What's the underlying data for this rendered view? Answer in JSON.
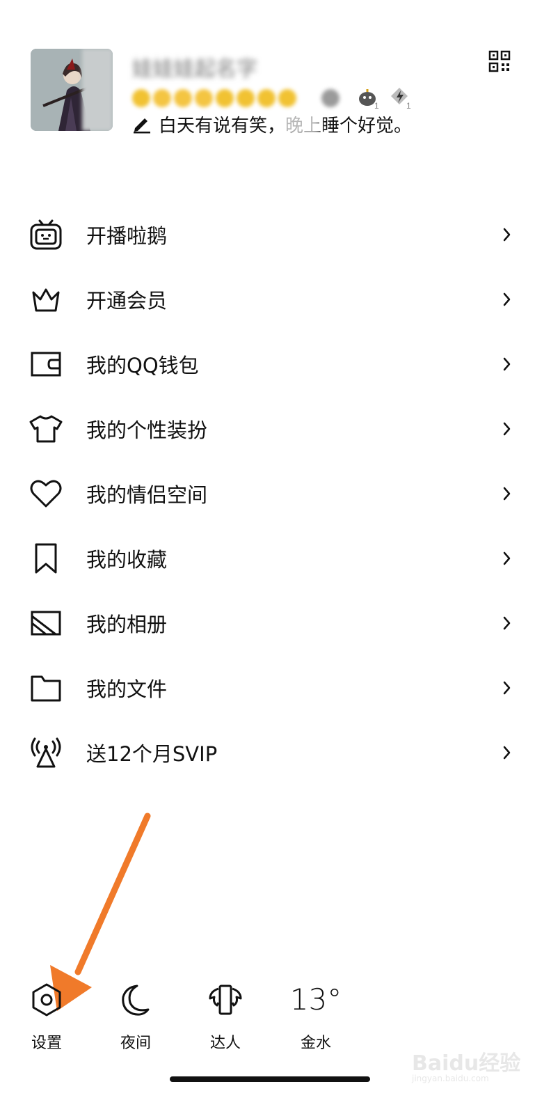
{
  "profile": {
    "nickname": "娃娃娃起名字",
    "signature": "白天有说有笑，晚上睡个好觉。"
  },
  "menu": [
    {
      "label": "开播啦鹅",
      "icon": "tv-icon"
    },
    {
      "label": "开通会员",
      "icon": "crown-icon"
    },
    {
      "label": "我的QQ钱包",
      "icon": "wallet-icon"
    },
    {
      "label": "我的个性装扮",
      "icon": "tshirt-icon"
    },
    {
      "label": "我的情侣空间",
      "icon": "heart-icon"
    },
    {
      "label": "我的收藏",
      "icon": "bookmark-icon"
    },
    {
      "label": "我的相册",
      "icon": "image-icon"
    },
    {
      "label": "我的文件",
      "icon": "folder-icon"
    },
    {
      "label": "送12个月SVIP",
      "icon": "broadcast-icon"
    }
  ],
  "bottom_bar": {
    "settings": "设置",
    "night": "夜间",
    "expert": "达人",
    "temperature": "13°",
    "city": "金水"
  },
  "watermark": {
    "brand": "Baidu经验",
    "url": "jingyan.baidu.com"
  },
  "colors": {
    "arrow": "#f07a2a",
    "text": "#111111",
    "background": "#ffffff"
  }
}
